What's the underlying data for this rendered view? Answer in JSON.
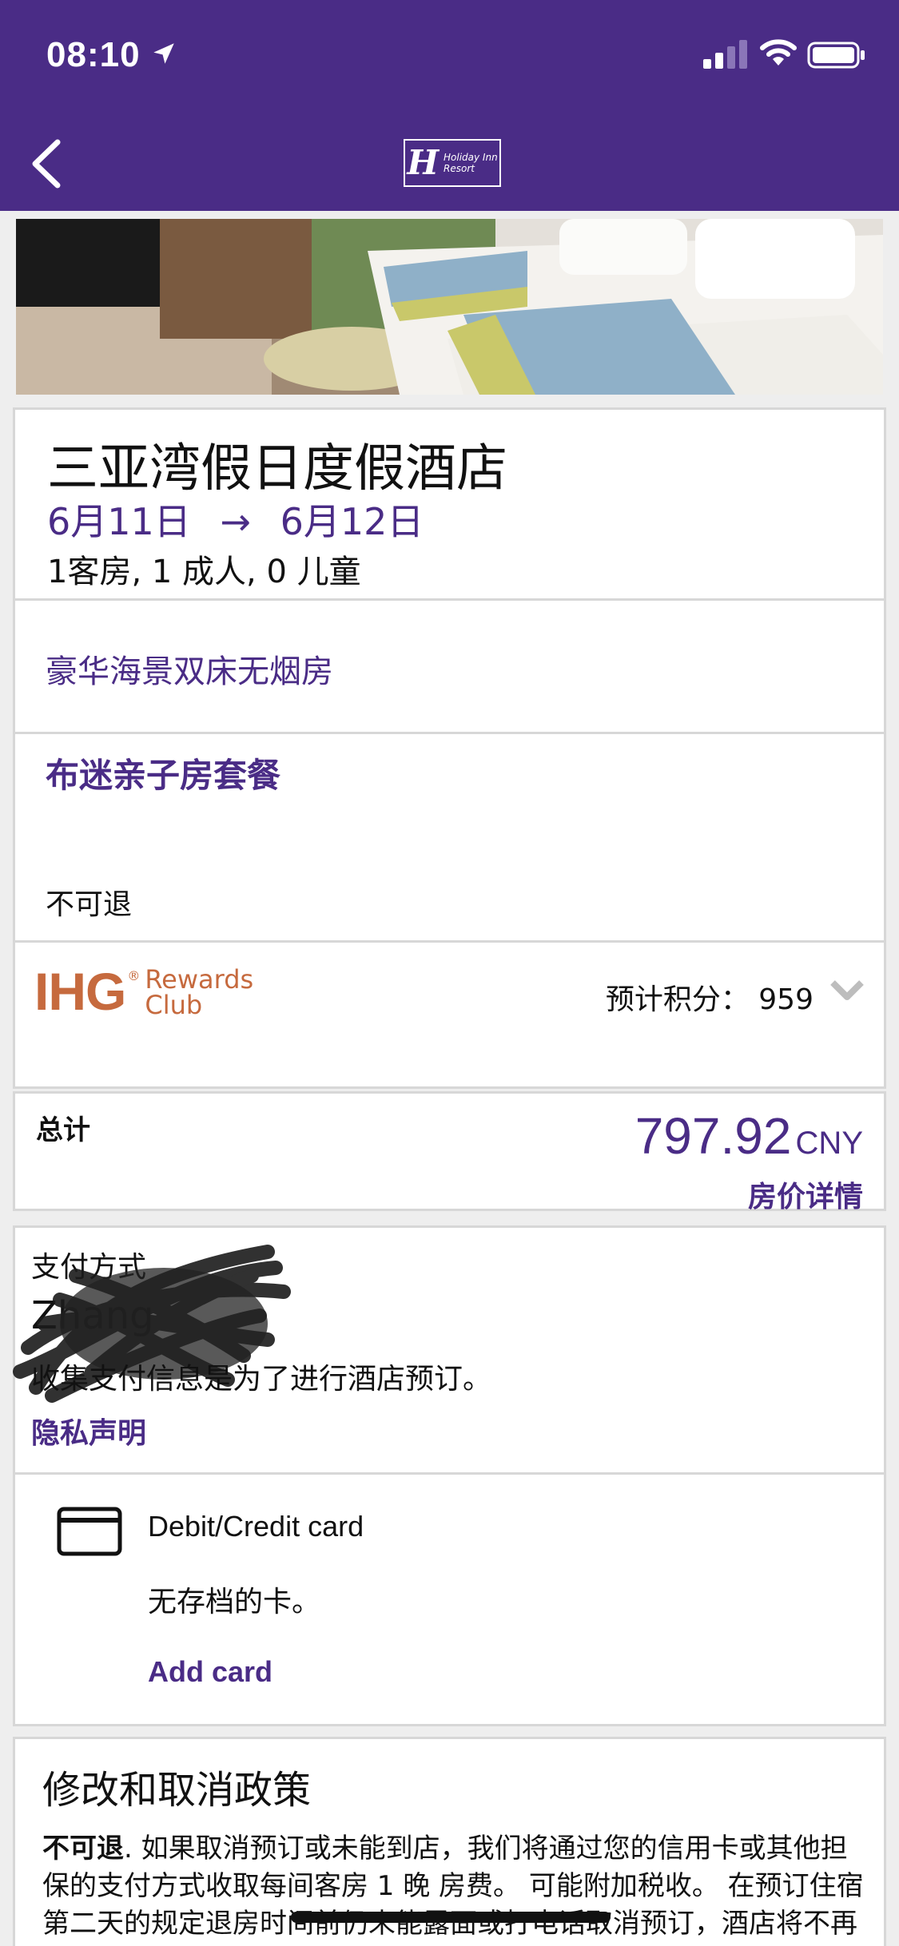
{
  "status_bar": {
    "time": "08:10",
    "icons": [
      "location-arrow-icon",
      "signal-icon",
      "wifi-icon",
      "battery-icon"
    ]
  },
  "nav": {
    "back_icon": "chevron-left-icon",
    "logo_letter": "H",
    "logo_text_line1": "Holiday Inn",
    "logo_text_line2": "Resort"
  },
  "hotel": {
    "name": "三亚湾假日度假酒店",
    "checkin": "6月11日",
    "arrow": "→",
    "checkout": "6月12日",
    "guests": "1客房, 1 成人, 0 儿童"
  },
  "room": {
    "type": "豪华海景双床无烟房",
    "package": "布迷亲子房套餐",
    "refund_policy": "不可退"
  },
  "rewards": {
    "brand": "IHG",
    "brand_mark": "®",
    "program_line1": "Rewards",
    "program_line2": "Club",
    "points_label": "预计积分：",
    "points_value": "959"
  },
  "total": {
    "label": "总计",
    "amount": "797.92",
    "currency": "CNY",
    "details_link": "房价详情"
  },
  "payment": {
    "title": "支付方式",
    "name": "Zhang",
    "note": "收集支付信息是为了进行酒店预订。",
    "privacy_link": "隐私声明"
  },
  "card": {
    "type_label": "Debit/Credit card",
    "no_card_text": "无存档的卡。",
    "add_card_label": "Add card"
  },
  "policy": {
    "title": "修改和取消政策",
    "bold_lead": "不可退",
    "text": ". 如果取消预订或未能到店，我们将通过您的信用卡或其他担保的支付方式收取每间客房 1 晚 房费。 可能附加税收。 在预订住宿第二天的规定退房时间前仍未能露面或打电话取消预订，酒店将不再保留您预订的客房。"
  },
  "colors": {
    "brand_purple": "#4a2c86",
    "ihg_orange": "#c66a3e",
    "page_bg": "#eeeeee"
  }
}
